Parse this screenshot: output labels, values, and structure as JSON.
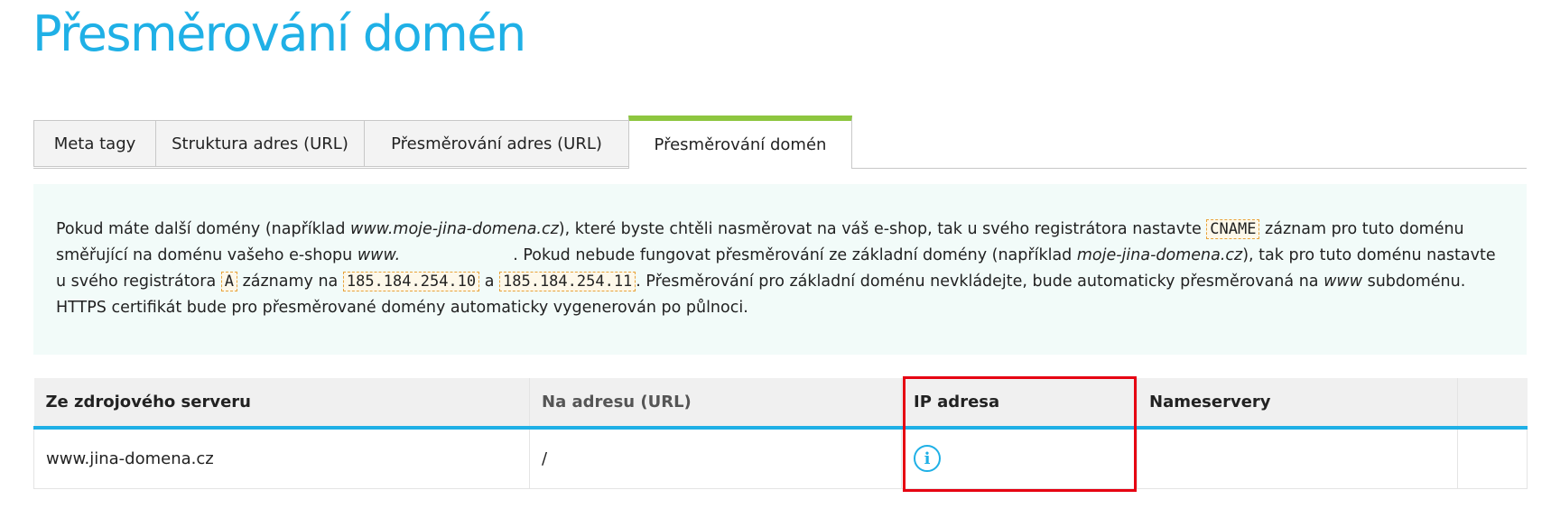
{
  "page": {
    "title": "Přesměrování domén"
  },
  "tabs": [
    {
      "label": "Meta tagy",
      "active": false
    },
    {
      "label": "Struktura adres (URL)",
      "active": false
    },
    {
      "label": "Přesměrování adres (URL)",
      "active": false
    },
    {
      "label": "Přesměrování domén",
      "active": true
    }
  ],
  "info": {
    "t1": "Pokud máte další domény (například ",
    "ex_domain": "www.moje-jina-domena.cz",
    "t2": "), které byste chtěli nasměrovat na váš e-shop, tak u svého registrátora nastavte ",
    "cname": "CNAME",
    "t3": " záznam pro tuto doménu směřující na doménu vašeho e-shopu ",
    "www_prefix": "www.",
    "t4": ". Pokud nebude fungovat přesměrování ze základní domény (například ",
    "ex_base": "moje-jina-domena.cz",
    "t5": "), tak pro tuto doménu nastavte u svého registrátora ",
    "a_record": "A",
    "t6": " záznamy na ",
    "ip1": "185.184.254.10",
    "t7": " a ",
    "ip2": "185.184.254.11",
    "t8": ". Přesměrování pro základní doménu nevkládejte, bude automaticky přesměrovaná na ",
    "www": "www",
    "t9": " subdoménu. HTTPS certifikát bude pro přesměrované domény automaticky vygenerován po půlnoci."
  },
  "table": {
    "headers": [
      "Ze zdrojového serveru",
      "Na adresu (URL)",
      "IP adresa",
      "Nameservery",
      ""
    ],
    "rows": [
      {
        "source": "www.jina-domena.cz",
        "target": "/",
        "ip_icon": "info-icon",
        "nameservers": "",
        "extra": ""
      }
    ]
  },
  "colors": {
    "accent": "#1fb0e6",
    "active_tab": "#8dc63f",
    "highlight": "#e60012"
  }
}
